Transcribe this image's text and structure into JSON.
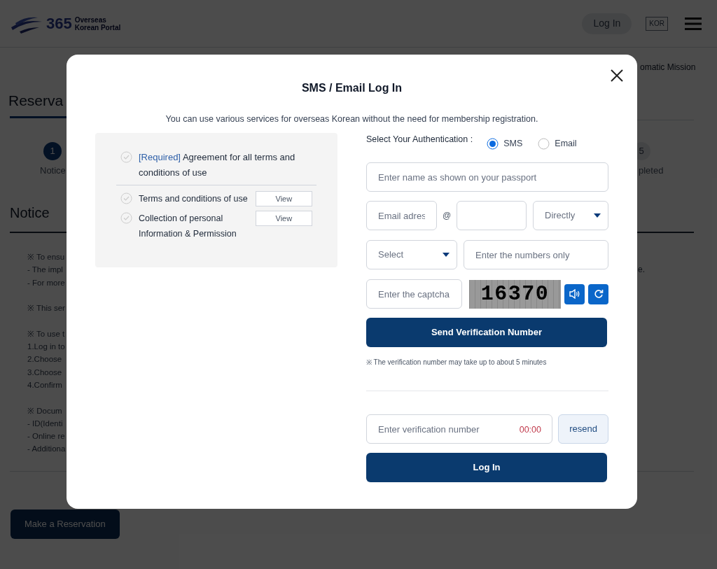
{
  "header": {
    "logo_number": "365",
    "logo_lines": [
      "Overseas",
      "Korean Portal"
    ],
    "login": "Log In",
    "language": "KOR"
  },
  "background": {
    "breadcrumb": "omatic Mission",
    "page_title": "Reserva",
    "steps": [
      {
        "number": "1",
        "label": "Notice",
        "selected": true
      },
      {
        "number": "5",
        "label": "pleted",
        "selected": false
      }
    ],
    "section_title": "Notice",
    "notice_groups": [
      [
        "※ To ensu",
        "- The impl",
        "- For more"
      ],
      [
        "※ This ser"
      ],
      [
        "※ To use t",
        "1.Log in to",
        "2.Choose",
        "3.Choose",
        "4.Confirm"
      ],
      [
        "※ Docum",
        "- ID(Identi",
        "- Online re",
        "- Additiona"
      ]
    ],
    "notice_right": "e.",
    "reserve_button": "Make a Reservation"
  },
  "modal": {
    "title": "SMS / Email Log In",
    "subtitle": "You can use various services for overseas Korean without the need for membership registration.",
    "agreements": [
      {
        "kind": "all",
        "tag": "[Required]",
        "text": "Agreement for all terms and conditions of use",
        "checked": false
      },
      {
        "kind": "item",
        "text": "Terms and conditions of use",
        "button": "View",
        "checked": false
      },
      {
        "kind": "item",
        "text": "Collection of personal Information & Permission",
        "button": "View",
        "checked": false
      }
    ],
    "auth_label": "Select Your Authentication :",
    "auth_options": [
      {
        "label": "SMS",
        "selected": true
      },
      {
        "label": "Email",
        "selected": false
      }
    ],
    "name_placeholder": "Enter name as shown on your passport",
    "email_placeholder": "Email adres",
    "at": "@",
    "domain_select": "Directly",
    "phone_select": "Select",
    "phone_placeholder": "Enter the numbers only",
    "captcha_placeholder": "Enter the captcha",
    "captcha_code": "16370",
    "send_button": "Send Verification Number",
    "note": "※ The verification number may take up to about 5 minutes",
    "verification_placeholder": "Enter verification number",
    "timer": "00:00",
    "resend": "resend",
    "login_button": "Log In"
  }
}
